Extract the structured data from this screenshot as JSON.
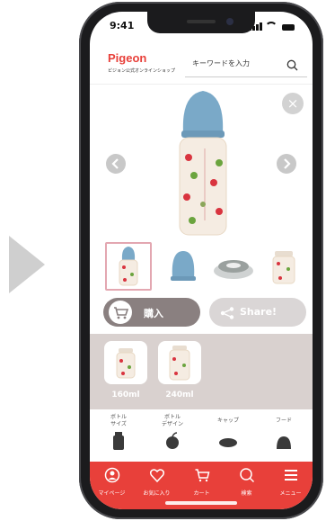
{
  "status": {
    "time": "9:41"
  },
  "header": {
    "brand": "Pigeon",
    "brand_sub": "ピジョン公式オンラインショップ",
    "search_placeholder": "キーワードを入力"
  },
  "viewer": {
    "close_icon": "×",
    "prev_icon": "chevron-left",
    "next_icon": "chevron-right"
  },
  "thumbnails": [
    {
      "name": "bottle-full"
    },
    {
      "name": "cap"
    },
    {
      "name": "ring"
    },
    {
      "name": "bottle-body"
    }
  ],
  "actions": {
    "buy_label": "購入",
    "share_label": "Share!"
  },
  "sizes": [
    {
      "label": "160ml"
    },
    {
      "label": "240ml"
    }
  ],
  "categories": [
    {
      "label": "ボトル\nサイズ"
    },
    {
      "label": "ボトル\nデザイン"
    },
    {
      "label": "キャップ"
    },
    {
      "label": "フード"
    }
  ],
  "tabbar": {
    "items": [
      {
        "label": "マイページ",
        "icon": "user-icon"
      },
      {
        "label": "お気に入り",
        "icon": "heart-icon"
      },
      {
        "label": "カート",
        "icon": "cart-icon"
      },
      {
        "label": "検索",
        "icon": "search-icon"
      },
      {
        "label": "メニュー",
        "icon": "menu-icon"
      }
    ]
  },
  "colors": {
    "brand_red": "#e8403a",
    "cap_blue": "#7aa9c8",
    "panel": "#d9d1cf",
    "buy": "#8a8080",
    "share": "#dad6d6"
  }
}
